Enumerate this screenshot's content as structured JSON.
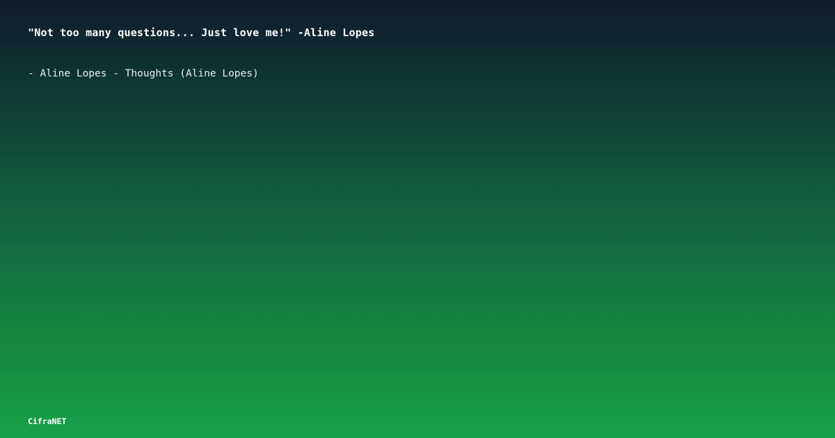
{
  "quote": {
    "text": "\"Not too many questions... Just love me!\" -Aline Lopes",
    "attribution": "- Aline Lopes - Thoughts (Aline Lopes)"
  },
  "brand": {
    "name": "CifraNET"
  },
  "colors": {
    "gradient_top": "#0f1a2e",
    "gradient_bottom": "#17a047",
    "text": "#ffffff"
  }
}
